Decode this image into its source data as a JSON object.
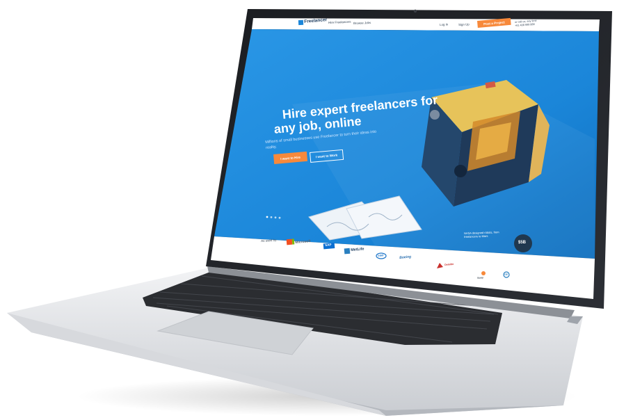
{
  "nav": {
    "brand": "Freelancer",
    "links": [
      "Hire Freelancers",
      "Browse Jobs"
    ],
    "login": "Log In",
    "signup": "Sign Up",
    "cta": "Post a Project",
    "contact_line1": "or call us, any time",
    "contact_line2": "+61 408 999 888"
  },
  "hero": {
    "title_line1": "Hire expert freelancers for",
    "title_line2": "any job, online",
    "subtitle": "Millions of small businesses use Freelancer to turn their ideas into reality.",
    "btn_hire": "I want to Hire",
    "btn_work": "I want to Work"
  },
  "trust": {
    "label": "As used by",
    "logos": [
      "Microsoft",
      "SAP",
      "MetLife",
      "intel",
      "Boeing",
      "Deloitte",
      "Sony",
      "GE"
    ]
  },
  "nasa": {
    "text": "NASA designed robots, from freelancers to Mars",
    "badge": "$5B"
  },
  "colors": {
    "hero_blue": "#1b86d9",
    "cta_orange": "#f7893b",
    "nav_bg": "#ffffff",
    "trust_bg": "#ffffff"
  }
}
